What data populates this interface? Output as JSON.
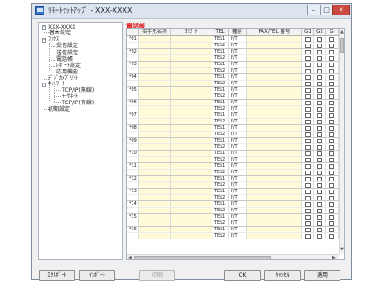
{
  "window": {
    "title": "ﾘﾓｰﾄｾｯﾄｱｯﾌﾟ - XXX-XXXX",
    "controls": {
      "minimize": "–",
      "maximize": "□",
      "close": "✕"
    }
  },
  "tree": {
    "root": "XXX-XXXX",
    "basic_settings": "基本設定",
    "fax": "ﾌｧｸｽ",
    "receive_settings": "受信設定",
    "send_settings": "送信設定",
    "phonebook": "電話帳",
    "report_settings": "ﾚﾎﾟｰﾄ設定",
    "advanced": "応用機能",
    "digital_camera_print": "ﾃﾞｼﾞｶﾒﾌﾟﾘﾝﾄ",
    "network": "ﾈｯﾄﾜｰｸ",
    "tcpip_wireless": "TCP/IP(無線)",
    "ethernet": "ｲｰｻﾈｯﾄ",
    "tcpip_wired": "TCP/IP(有線)",
    "initial_settings": "初期設定"
  },
  "panel_title": "電話帳",
  "table": {
    "headers": [
      "",
      "相手先名称",
      "ﾖﾐｶﾞﾅ",
      "TEL",
      "種別",
      "FAX/TEL 番号",
      "G1",
      "G2",
      "G"
    ],
    "entries": [
      {
        "no": "*01",
        "tel1": "TEL1",
        "tel2": "TEL2",
        "type1": "F/T",
        "type2": "F/T"
      },
      {
        "no": "*02",
        "tel1": "TEL1",
        "tel2": "TEL2",
        "type1": "F/T",
        "type2": "F/T"
      },
      {
        "no": "*03",
        "tel1": "TEL1",
        "tel2": "TEL2",
        "type1": "F/T",
        "type2": "F/T"
      },
      {
        "no": "*04",
        "tel1": "TEL1",
        "tel2": "TEL2",
        "type1": "F/T",
        "type2": "F/T"
      },
      {
        "no": "*05",
        "tel1": "TEL1",
        "tel2": "TEL2",
        "type1": "F/T",
        "type2": "F/T"
      },
      {
        "no": "*06",
        "tel1": "TEL1",
        "tel2": "TEL2",
        "type1": "F/T",
        "type2": "F/T"
      },
      {
        "no": "*07",
        "tel1": "TEL1",
        "tel2": "TEL2",
        "type1": "F/T",
        "type2": "F/T"
      },
      {
        "no": "*08",
        "tel1": "TEL1",
        "tel2": "TEL2",
        "type1": "F/T",
        "type2": "F/T"
      },
      {
        "no": "*09",
        "tel1": "TEL1",
        "tel2": "TEL2",
        "type1": "F/T",
        "type2": "F/T"
      },
      {
        "no": "*10",
        "tel1": "TEL1",
        "tel2": "TEL2",
        "type1": "F/T",
        "type2": "F/T"
      },
      {
        "no": "*11",
        "tel1": "TEL1",
        "tel2": "TEL2",
        "type1": "F/T",
        "type2": "F/T"
      },
      {
        "no": "*12",
        "tel1": "TEL1",
        "tel2": "TEL2",
        "type1": "F/T",
        "type2": "F/T"
      },
      {
        "no": "*13",
        "tel1": "TEL1",
        "tel2": "TEL2",
        "type1": "F/T",
        "type2": "F/T"
      },
      {
        "no": "*14",
        "tel1": "TEL1",
        "tel2": "TEL2",
        "type1": "F/T",
        "type2": "F/T"
      },
      {
        "no": "*15",
        "tel1": "TEL1",
        "tel2": "TEL2",
        "type1": "F/T",
        "type2": "F/T"
      },
      {
        "no": "*16",
        "tel1": "TEL1",
        "tel2": "TEL2",
        "type1": "F/T",
        "type2": "F/T"
      }
    ]
  },
  "buttons": {
    "export": "ｴｸｽﾎﾟｰﾄ",
    "import": "ｲﾝﾎﾟｰﾄ",
    "print": "印刷",
    "ok": "OK",
    "cancel": "ｷｬﾝｾﾙ",
    "apply": "適用"
  },
  "colors": {
    "panel_title": "#e01616",
    "row_highlight": "#fffbd8",
    "close_button": "#c9483f"
  },
  "icons": {
    "app": "app-window-icon",
    "expand": "tree-collapse-icon",
    "scroll_up": "scroll-up-arrow-icon",
    "scroll_down": "scroll-down-arrow-icon",
    "scroll_left": "scroll-left-arrow-icon",
    "scroll_right": "scroll-right-arrow-icon"
  }
}
